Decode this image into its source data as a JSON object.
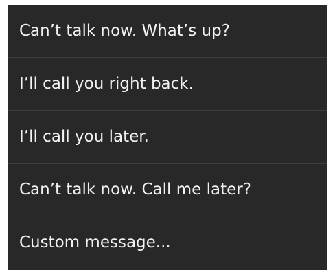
{
  "quick_responses": {
    "items": [
      {
        "label": "Can’t talk now. What’s up?"
      },
      {
        "label": "I’ll call you right back."
      },
      {
        "label": "I’ll call you later."
      },
      {
        "label": "Can’t talk now. Call me later?"
      },
      {
        "label": "Custom message..."
      }
    ]
  },
  "colors": {
    "background": "#282828",
    "divider": "#3c3c3c",
    "text": "#f2f2f2"
  }
}
